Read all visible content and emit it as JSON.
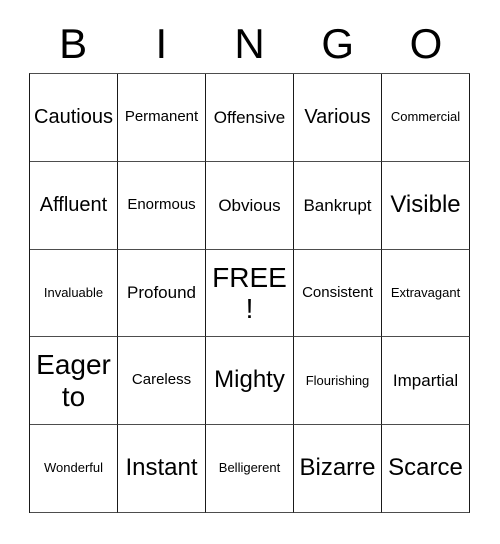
{
  "card": {
    "title": "BINGO",
    "header_letters": [
      "B",
      "I",
      "N",
      "G",
      "O"
    ],
    "free_space_label": "FREE!",
    "colors": {
      "background": "#ffffff",
      "text": "#000000",
      "grid_line": "#1a1a1a",
      "grid_line_light": "#4d4d4d"
    },
    "rows": [
      [
        {
          "label": "Cautious",
          "size": "fs-l"
        },
        {
          "label": "Permanent",
          "size": "fs-s"
        },
        {
          "label": "Offensive",
          "size": "fs-m"
        },
        {
          "label": "Various",
          "size": "fs-l"
        },
        {
          "label": "Commercial",
          "size": "fs-xs"
        }
      ],
      [
        {
          "label": "Affluent",
          "size": "fs-l"
        },
        {
          "label": "Enormous",
          "size": "fs-s"
        },
        {
          "label": "Obvious",
          "size": "fs-m"
        },
        {
          "label": "Bankrupt",
          "size": "fs-m"
        },
        {
          "label": "Visible",
          "size": "fs-xl"
        }
      ],
      [
        {
          "label": "Invaluable",
          "size": "fs-xs"
        },
        {
          "label": "Profound",
          "size": "fs-m"
        },
        {
          "label": "FREE!",
          "size": "fs-xxl"
        },
        {
          "label": "Consistent",
          "size": "fs-s"
        },
        {
          "label": "Extravagant",
          "size": "fs-xs"
        }
      ],
      [
        {
          "label": "Eager to",
          "size": "fs-xxl"
        },
        {
          "label": "Careless",
          "size": "fs-s"
        },
        {
          "label": "Mighty",
          "size": "fs-xl"
        },
        {
          "label": "Flourishing",
          "size": "fs-xs"
        },
        {
          "label": "Impartial",
          "size": "fs-m"
        }
      ],
      [
        {
          "label": "Wonderful",
          "size": "fs-xs"
        },
        {
          "label": "Instant",
          "size": "fs-xl"
        },
        {
          "label": "Belligerent",
          "size": "fs-xs"
        },
        {
          "label": "Bizarre",
          "size": "fs-xl"
        },
        {
          "label": "Scarce",
          "size": "fs-xl"
        }
      ]
    ]
  }
}
